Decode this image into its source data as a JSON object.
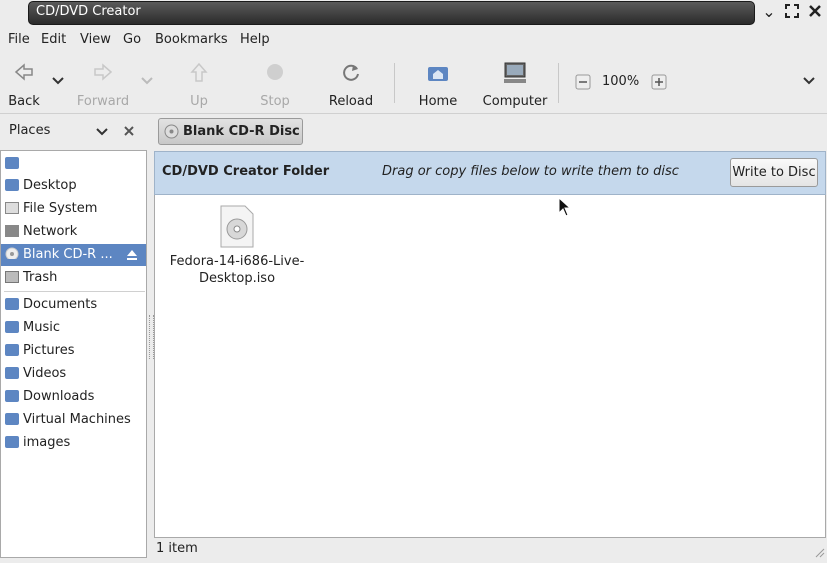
{
  "window": {
    "title": "CD/DVD Creator"
  },
  "menu": [
    "File",
    "Edit",
    "View",
    "Go",
    "Bookmarks",
    "Help"
  ],
  "toolbar": {
    "back": "Back",
    "forward": "Forward",
    "up": "Up",
    "stop": "Stop",
    "reload": "Reload",
    "home": "Home",
    "computer": "Computer",
    "zoom": "100%"
  },
  "sidebar": {
    "header": "Places",
    "items": [
      "Desktop",
      "File System",
      "Network",
      "Blank CD-R ...",
      "Trash",
      "Documents",
      "Music",
      "Pictures",
      "Videos",
      "Downloads",
      "Virtual Machines",
      "images"
    ]
  },
  "pathbar": {
    "button": "Blank CD-R Disc"
  },
  "banner": {
    "title": "CD/DVD Creator Folder",
    "hint": "Drag or copy files below to write them to disc",
    "button": "Write to Disc"
  },
  "files": [
    {
      "name_line1": "Fedora-14-i686-Live-",
      "name_line2": "Desktop.iso"
    }
  ],
  "status": {
    "text": "1 item"
  },
  "colors": {
    "selection": "#5d86c2",
    "banner": "#c5d8ec"
  }
}
